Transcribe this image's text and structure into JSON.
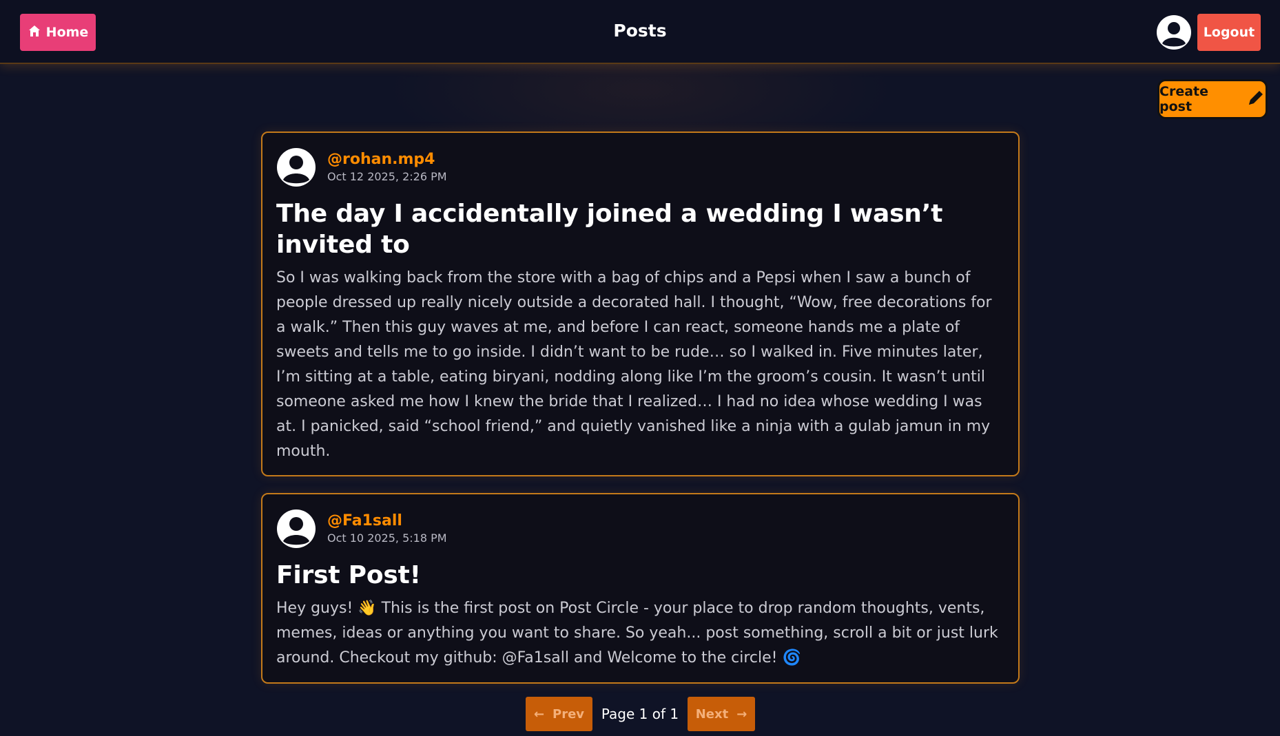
{
  "navbar": {
    "home_label": "Home",
    "title": "Posts",
    "logout_label": "Logout",
    "home_icon": "home-icon",
    "avatar_icon": "user-circle-icon"
  },
  "create_post": {
    "label": "Create post",
    "icon": "pencil-icon"
  },
  "posts": [
    {
      "username": "@rohan.mp4",
      "date": "Oct 12 2025, 2:26 PM",
      "title": "The day I accidentally joined a wedding I wasn’t invited to",
      "body": "So I was walking back from the store with a bag of chips and a Pepsi when I saw a bunch of people dressed up really nicely outside a decorated hall. I thought, “Wow, free decorations for a walk.” Then this guy waves at me, and before I can react, someone hands me a plate of sweets and tells me to go inside. I didn’t want to be rude… so I walked in. Five minutes later, I’m sitting at a table, eating biryani, nodding along like I’m the groom’s cousin. It wasn’t until someone asked me how I knew the bride that I realized… I had no idea whose wedding I was at. I panicked, said “school friend,” and quietly vanished like a ninja with a gulab jamun in my mouth."
    },
    {
      "username": "@Fa1sall",
      "date": "Oct 10 2025, 5:18 PM",
      "title": "First Post!",
      "body": "Hey guys! 👋 This is the first post on Post Circle - your place to drop random thoughts, vents, memes, ideas or anything you want to share. So yeah... post something, scroll a bit or just lurk around. Checkout my github: @Fa1sall and Welcome to the circle! 🌀"
    }
  ],
  "pagination": {
    "prev_label": "Prev",
    "next_label": "Next",
    "page_text": "Page 1 of 1",
    "prev_arrow": "←",
    "next_arrow": "→"
  },
  "colors": {
    "background": "#0f1326",
    "home_button": "#e83e77",
    "logout_button": "#f05545",
    "accent_orange": "#ff8c00",
    "card_border": "#c47a1a"
  }
}
